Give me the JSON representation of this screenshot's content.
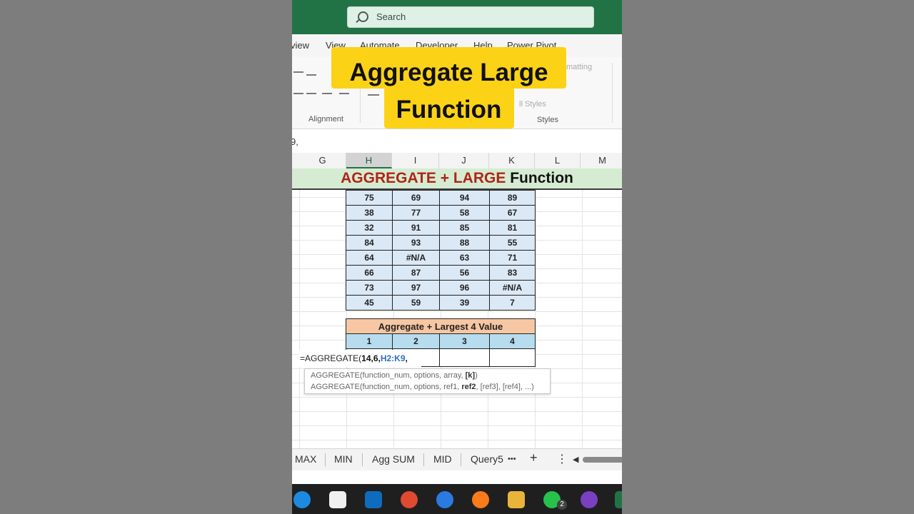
{
  "search": {
    "placeholder": "Search"
  },
  "menu": [
    "view",
    "View",
    "Automate",
    "Developer",
    "Help",
    "Power Pivot"
  ],
  "ribbon": {
    "alignment_label": "Alignment",
    "styles_label": "Styles",
    "cond_format_fragment": "matting",
    "cell_styles_fragment": "ll Styles"
  },
  "formula_bar_text": "9,",
  "columns": [
    "G",
    "H",
    "I",
    "J",
    "K",
    "L",
    "M"
  ],
  "banner": {
    "part1": "AGGREGATE + LARGE",
    "part2": "Function"
  },
  "data_rows": [
    [
      "75",
      "69",
      "94",
      "89"
    ],
    [
      "38",
      "77",
      "58",
      "67"
    ],
    [
      "32",
      "91",
      "85",
      "81"
    ],
    [
      "84",
      "93",
      "88",
      "55"
    ],
    [
      "64",
      "#N/A",
      "63",
      "71"
    ],
    [
      "66",
      "87",
      "56",
      "83"
    ],
    [
      "73",
      "97",
      "96",
      "#N/A"
    ],
    [
      "45",
      "59",
      "39",
      "7"
    ]
  ],
  "agg": {
    "title": "Aggregate + Largest 4  Value",
    "headers": [
      "1",
      "2",
      "3",
      "4"
    ]
  },
  "formula": {
    "fn": "=AGGREGATE(",
    "args": "14,6,",
    "ref": "H2:K9",
    "tail": ","
  },
  "tooltip": {
    "line1_a": "AGGREGATE(function_num, options, array, ",
    "line1_b": "[k]",
    "line1_c": ")",
    "line2_a": "AGGREGATE(function_num, options, ref1, ",
    "line2_b": "ref2",
    "line2_c": ", [ref3], [ref4], ...)"
  },
  "sheet_tabs": [
    "MAX",
    "MIN",
    "Agg SUM",
    "MID",
    "Query5",
    "•••",
    "+",
    "⋮",
    "◀"
  ],
  "headline": {
    "line1": "Aggregate Large",
    "line2": "Function"
  },
  "taskbar_badge": "2",
  "colors": {
    "excel_green": "#217346",
    "banner_red": "#b02418",
    "headline_yellow": "#fcd217",
    "table_blue": "#dbe8f5",
    "agg_orange": "#f7c7a3",
    "agg_header_blue": "#b7dcee"
  }
}
